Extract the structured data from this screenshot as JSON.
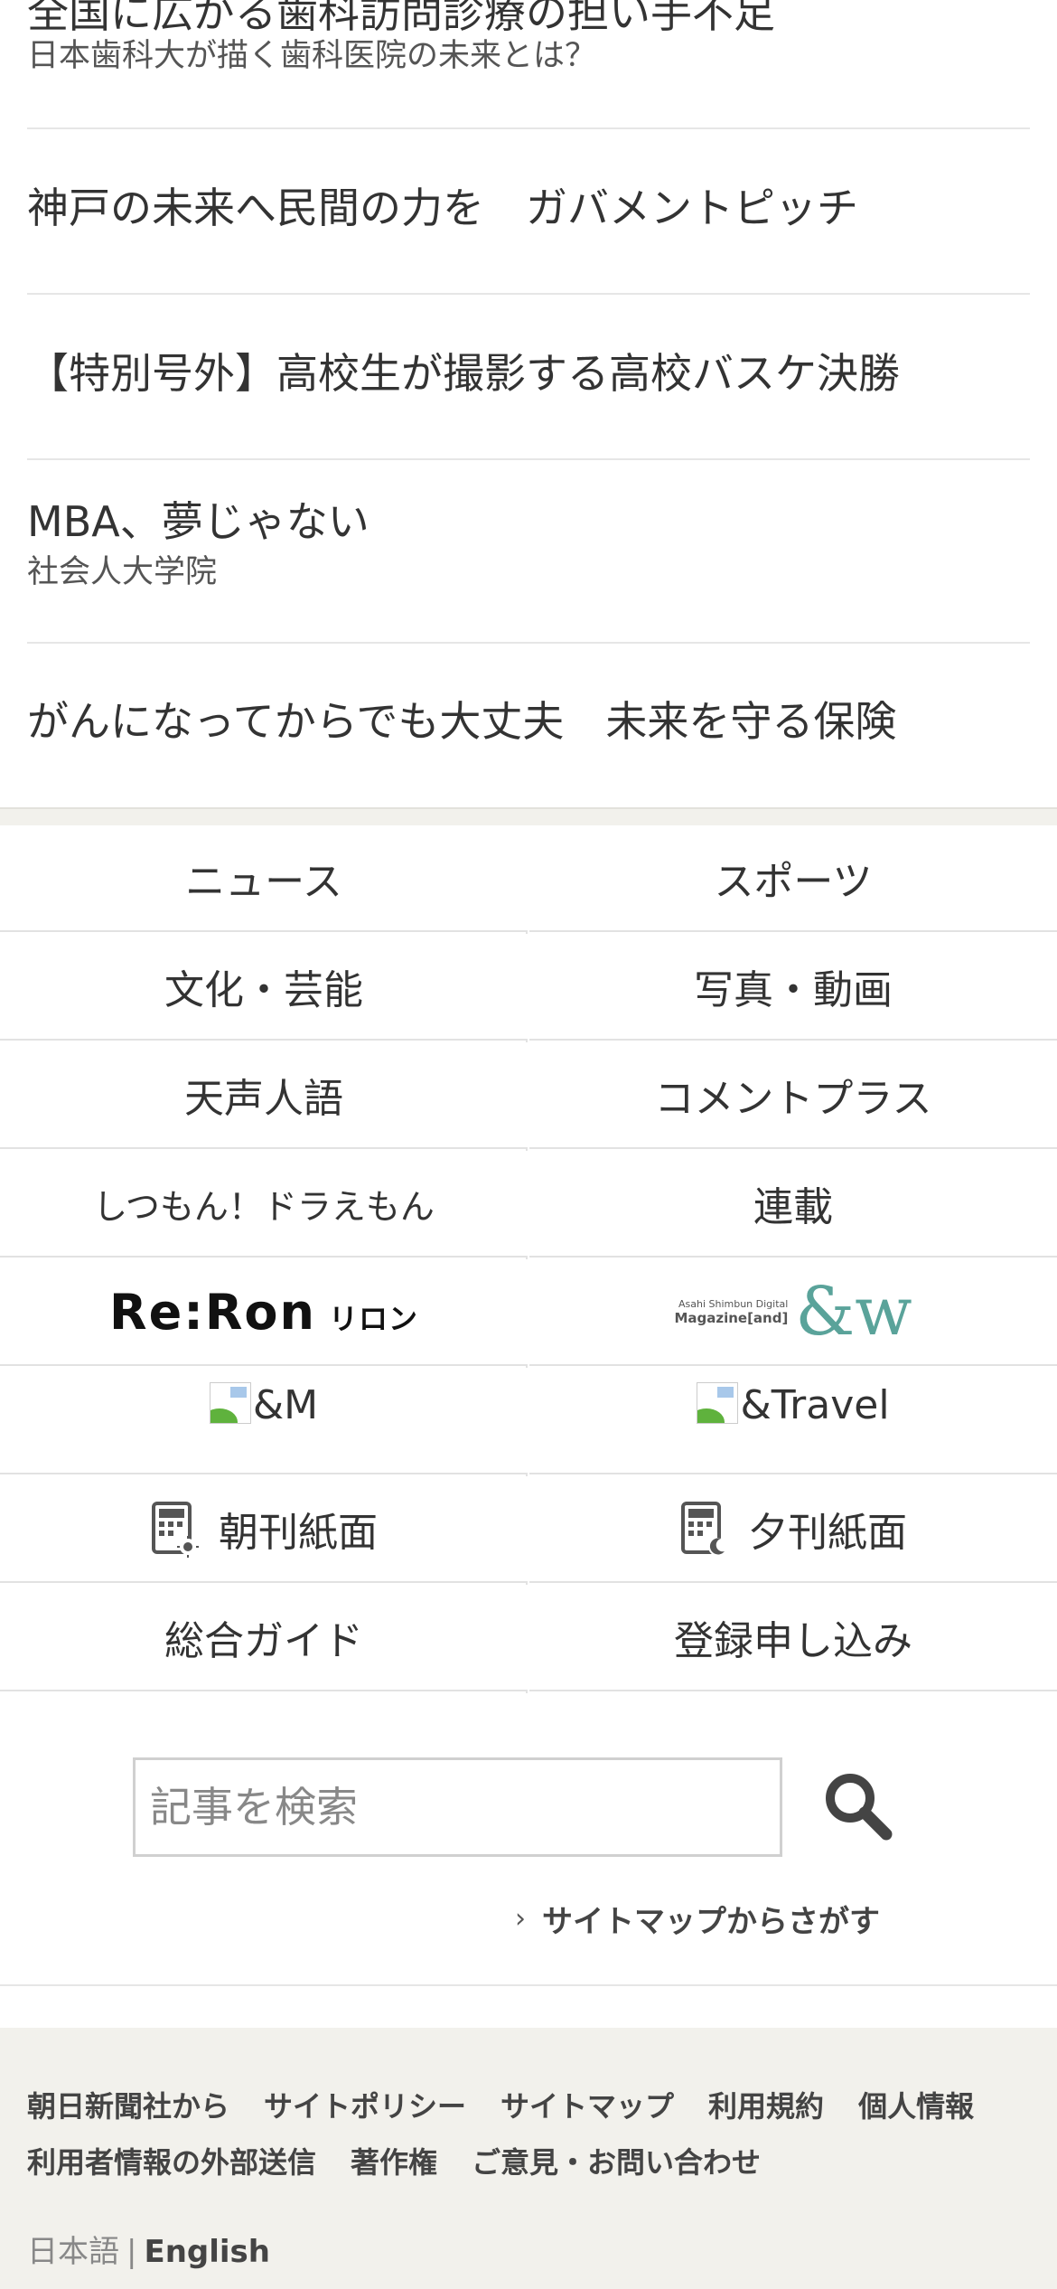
{
  "promos": [
    {
      "title": "全国に広がる歯科訪問診療の担い手不足",
      "subtitle": "日本歯科大が描く歯科医院の未来とは？"
    },
    {
      "title": "神戸の未来へ民間の力を　ガバメントピッチ",
      "subtitle": ""
    },
    {
      "title": "【特別号外】高校生が撮影する高校バスケ決勝",
      "subtitle": ""
    },
    {
      "title": "MBA、夢じゃない",
      "subtitle": "社会人大学院"
    },
    {
      "title": "がんになってからでも大丈夫　未来を守る保険",
      "subtitle": ""
    }
  ],
  "nav": {
    "news": "ニュース",
    "sports": "スポーツ",
    "culture": "文化・芸能",
    "photo_video": "写真・動画",
    "tensei_jingo": "天声人語",
    "comment_plus": "コメントプラス",
    "doraemon": "しつもん！ドラえもん",
    "series": "連載",
    "reron_logo": "Re:Ron",
    "reron_kana": "リロン",
    "magazine_line1": "Asahi Shimbun Digital",
    "magazine_line2": "Magazine[and]",
    "magazine_amp": "&w",
    "and_m": "&M",
    "and_travel": "&Travel",
    "morning_paper": "朝刊紙面",
    "evening_paper": "夕刊紙面",
    "guide": "総合ガイド",
    "signup": "登録申し込み"
  },
  "search": {
    "placeholder": "記事を検索",
    "sitemap": "サイトマップからさがす"
  },
  "footer": {
    "links": [
      "朝日新聞社から",
      "サイトポリシー",
      "サイトマップ",
      "利用規約",
      "個人情報",
      "利用者情報の外部送信",
      "著作権",
      "ご意見・お問い合わせ"
    ],
    "lang_ja": "日本語",
    "lang_sep": "|",
    "lang_en": "English"
  },
  "colors": {
    "footer_bg": "#f2f1ec",
    "accent_teal": "#5aa39a",
    "text": "#333333"
  }
}
